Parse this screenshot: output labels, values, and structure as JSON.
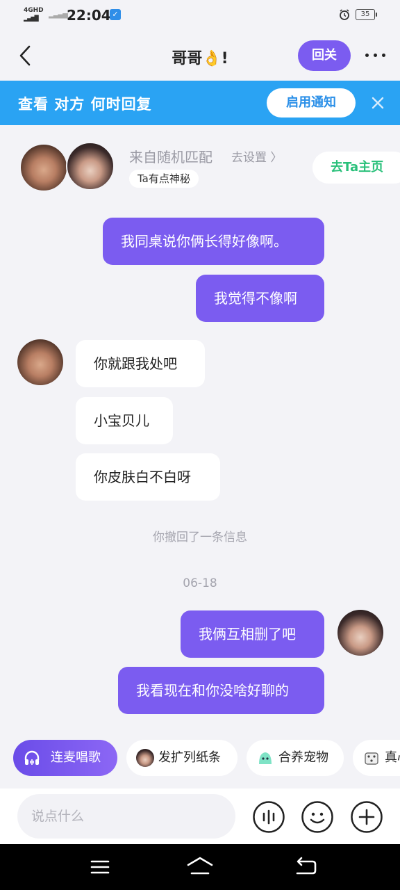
{
  "status_bar": {
    "network": "4GHD",
    "time": "22:04",
    "battery": "35"
  },
  "nav": {
    "title": "哥哥👌!",
    "follow_back_label": "回关",
    "back_icon": "chevron-left-icon",
    "more_icon": "more-dots-icon"
  },
  "banner": {
    "text": "查看 对方 何时回复",
    "enable_label": "启用通知",
    "close_icon": "close-icon"
  },
  "match_card": {
    "source": "来自随机匹配",
    "settings_link": "去设置 〉",
    "tag": "Ta有点神秘",
    "homepage_label": "去Ta主页"
  },
  "messages": [
    {
      "direction": "out",
      "text": "我同桌说你俩长得好像啊。"
    },
    {
      "direction": "out",
      "text": "我觉得不像啊"
    },
    {
      "direction": "in",
      "text": "你就跟我处吧"
    },
    {
      "direction": "in",
      "text": "小宝贝儿"
    },
    {
      "direction": "in",
      "text": "你皮肤白不白呀"
    },
    {
      "direction": "out",
      "text": "我俩互相删了吧"
    },
    {
      "direction": "out",
      "text": "我看现在和你没啥好聊的"
    }
  ],
  "system_notes": {
    "recall": "你撤回了一条信息",
    "date": "06-18"
  },
  "quick_actions": [
    {
      "label": "连麦唱歌",
      "icon": "headphones-icon"
    },
    {
      "label": "发扩列纸条",
      "icon": "avatar-icon"
    },
    {
      "label": "合养宠物",
      "icon": "pet-icon"
    },
    {
      "label": "真心",
      "icon": "dice-icon"
    }
  ],
  "input": {
    "placeholder": "说点什么"
  },
  "colors": {
    "accent": "#7b5cf0",
    "banner": "#2aa3f3",
    "homepage_text": "#29c07a",
    "background": "#f3f3f7"
  }
}
